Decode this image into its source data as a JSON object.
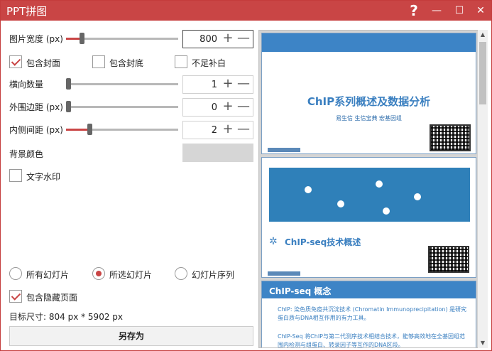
{
  "window": {
    "title": "PPT拼图"
  },
  "titlebar": {
    "help_icon": "?",
    "minimize_icon": "—",
    "maximize_icon": "☐",
    "close_icon": "✕"
  },
  "settings": {
    "image_width": {
      "label": "图片宽度 (px)",
      "value": "800",
      "slider_fraction": 0.12
    },
    "include_cover": {
      "label": "包含封面",
      "checked": true
    },
    "include_back": {
      "label": "包含封底",
      "checked": false
    },
    "no_fill": {
      "label": "不足补白",
      "checked": false
    },
    "horizontal_count": {
      "label": "横向数量",
      "value": "1",
      "slider_fraction": 0.0
    },
    "outer_margin": {
      "label": "外围边距 (px)",
      "value": "0",
      "slider_fraction": 0.0
    },
    "inner_spacing": {
      "label": "内侧间距 (px)",
      "value": "2",
      "slider_fraction": 0.19
    },
    "bg_color": {
      "label": "背景颜色",
      "color": "#d6d6d6"
    },
    "text_watermark": {
      "label": "文字水印",
      "checked": false
    }
  },
  "range": {
    "all_slides": {
      "label": "所有幻灯片",
      "checked": false
    },
    "selected_slides": {
      "label": "所选幻灯片",
      "checked": true
    },
    "slide_sequence": {
      "label": "幻灯片序列",
      "checked": false
    }
  },
  "include_hidden": {
    "label": "包含隐藏页面",
    "checked": true
  },
  "target_size": "目标尺寸:   804 px *  5902 px",
  "save_button": "另存为",
  "preview": {
    "slide1": {
      "title": "ChIP系列概述及数据分析",
      "subtitle": "易生信 生信宝典 宏基因组"
    },
    "slide2": {
      "title": "ChIP-seq技术概述"
    },
    "slide3": {
      "title": "ChIP-seq 概念",
      "p1": "ChIP: 染色质免疫共沉淀技术 (Chromatin Immunoprecipitation) 是研究蛋白质与DNA相互作用的有力工具。",
      "p2": "ChIP-Seq 将ChIP与第二代测序技术相结合技术，能够高效地在全基因组范围内检测与组蛋白、转录因子等互作的DNA区段。"
    }
  },
  "colors": {
    "accent": "#c94545",
    "slide_blue": "#3d84c6"
  }
}
